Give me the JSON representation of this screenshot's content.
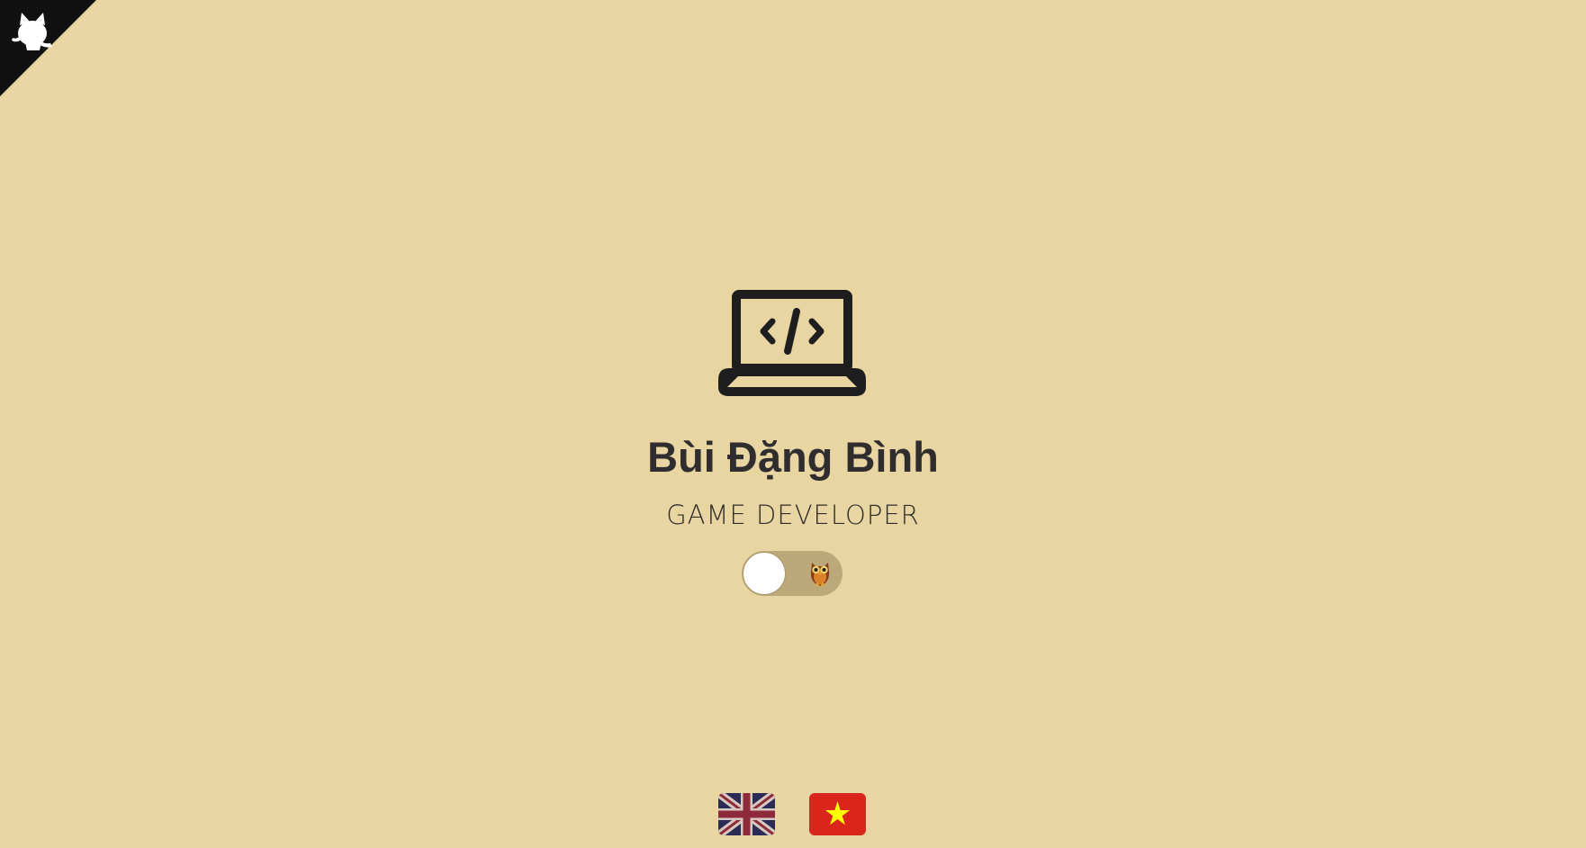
{
  "page": {
    "name": "Bùi Đặng Bình",
    "role": "GAME DEVELOPER"
  },
  "colors": {
    "background": "#e8d5a1",
    "text": "#2f2d2d",
    "corner": "#111111",
    "toggle_track": "#bca97a",
    "toggle_knob": "#ffffff",
    "flag_vn_red": "#da251d",
    "flag_vn_star": "#ffff00"
  },
  "icons": {
    "corner": "github-octocat-icon",
    "hero": "laptop-code-icon",
    "toggle": "owl-icon"
  },
  "theme_toggle": {
    "state": "off"
  },
  "languages": [
    {
      "code": "en",
      "flag": "uk-flag-icon"
    },
    {
      "code": "vi",
      "flag": "vietnam-flag-icon"
    }
  ]
}
